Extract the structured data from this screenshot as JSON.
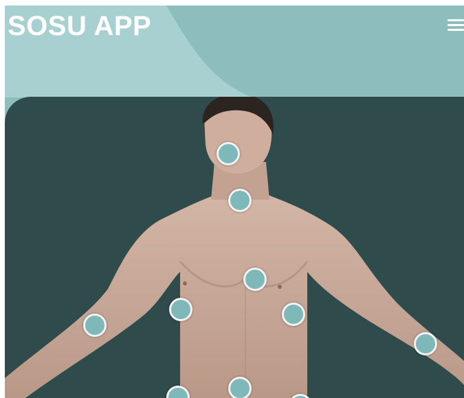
{
  "header": {
    "title": "SOSU APP",
    "menu_icon": "hamburger-menu-icon"
  },
  "colors": {
    "header_bg": "#8dbdbd",
    "header_light": "#a9d0d0",
    "viewer_bg": "#2f4b4c",
    "hotspot_fill": "#7fb8b8",
    "hotspot_ring": "#f2f2f2",
    "skin": "#c8a898",
    "hair": "#2c2420"
  },
  "body_points": [
    {
      "name": "face"
    },
    {
      "name": "neck"
    },
    {
      "name": "chest"
    },
    {
      "name": "left-chest"
    },
    {
      "name": "right-chest"
    },
    {
      "name": "left-forearm"
    },
    {
      "name": "right-forearm"
    },
    {
      "name": "abdomen"
    },
    {
      "name": "left-hip"
    },
    {
      "name": "right-hip"
    }
  ]
}
